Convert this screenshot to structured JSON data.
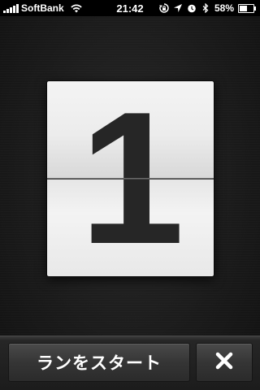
{
  "status_bar": {
    "carrier": "SoftBank",
    "time": "21:42",
    "battery_percent": "58%",
    "battery_level": 0.58,
    "icons": [
      "signal-bars-icon",
      "wifi-icon",
      "rotation-lock-icon",
      "location-arrow-icon",
      "alarm-clock-icon",
      "bluetooth-icon",
      "battery-icon"
    ]
  },
  "countdown": {
    "digit": "1"
  },
  "toolbar": {
    "start_label": "ランをスタート",
    "close_label": "✕",
    "close_icon": "close-icon"
  }
}
